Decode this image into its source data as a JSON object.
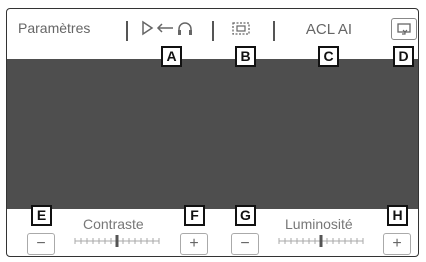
{
  "header": {
    "title": "Paramètres",
    "mode_label": "ACL AI"
  },
  "callouts": {
    "a": "A",
    "b": "B",
    "c": "C",
    "d": "D",
    "e": "E",
    "f": "F",
    "g": "G",
    "h": "H"
  },
  "controls": {
    "contrast": {
      "label": "Contraste",
      "minus": "−",
      "plus": "+",
      "level": 0.5
    },
    "brightness": {
      "label": "Luminosité",
      "minus": "−",
      "plus": "+",
      "level": 0.5
    }
  },
  "icons": {
    "input_switch": "play-to-headphones-icon",
    "aspect": "aspect-ratio-icon",
    "back": "back-screen-icon"
  }
}
